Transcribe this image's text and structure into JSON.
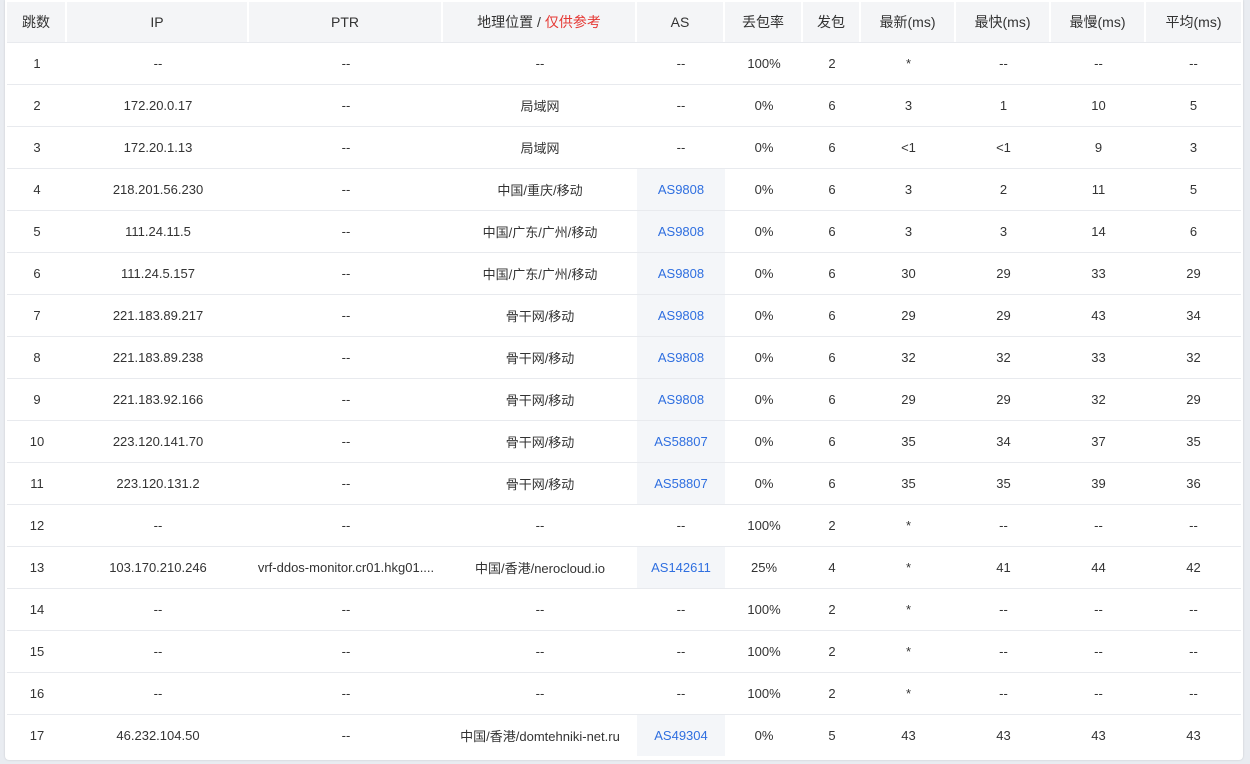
{
  "header": {
    "hop": "跳数",
    "ip": "IP",
    "ptr": "PTR",
    "geo": "地理位置",
    "geo_sep": " / ",
    "geo_note": "仅供参考",
    "as": "AS",
    "loss": "丢包率",
    "sent": "发包",
    "last": "最新(ms)",
    "best": "最快(ms)",
    "worst": "最慢(ms)",
    "avg": "平均(ms)"
  },
  "rows": [
    {
      "hop": "1",
      "ip": "--",
      "ptr": "--",
      "geo": "--",
      "as": "--",
      "as_link": false,
      "loss": "100%",
      "sent": "2",
      "last": "*",
      "best": "--",
      "worst": "--",
      "avg": "--"
    },
    {
      "hop": "2",
      "ip": "172.20.0.17",
      "ptr": "--",
      "geo": "局域网",
      "as": "--",
      "as_link": false,
      "loss": "0%",
      "sent": "6",
      "last": "3",
      "best": "1",
      "worst": "10",
      "avg": "5"
    },
    {
      "hop": "3",
      "ip": "172.20.1.13",
      "ptr": "--",
      "geo": "局域网",
      "as": "--",
      "as_link": false,
      "loss": "0%",
      "sent": "6",
      "last": "<1",
      "best": "<1",
      "worst": "9",
      "avg": "3"
    },
    {
      "hop": "4",
      "ip": "218.201.56.230",
      "ptr": "--",
      "geo": "中国/重庆/移动",
      "as": "AS9808",
      "as_link": true,
      "loss": "0%",
      "sent": "6",
      "last": "3",
      "best": "2",
      "worst": "11",
      "avg": "5"
    },
    {
      "hop": "5",
      "ip": "111.24.11.5",
      "ptr": "--",
      "geo": "中国/广东/广州/移动",
      "as": "AS9808",
      "as_link": true,
      "loss": "0%",
      "sent": "6",
      "last": "3",
      "best": "3",
      "worst": "14",
      "avg": "6"
    },
    {
      "hop": "6",
      "ip": "111.24.5.157",
      "ptr": "--",
      "geo": "中国/广东/广州/移动",
      "as": "AS9808",
      "as_link": true,
      "loss": "0%",
      "sent": "6",
      "last": "30",
      "best": "29",
      "worst": "33",
      "avg": "29"
    },
    {
      "hop": "7",
      "ip": "221.183.89.217",
      "ptr": "--",
      "geo": "骨干网/移动",
      "as": "AS9808",
      "as_link": true,
      "loss": "0%",
      "sent": "6",
      "last": "29",
      "best": "29",
      "worst": "43",
      "avg": "34"
    },
    {
      "hop": "8",
      "ip": "221.183.89.238",
      "ptr": "--",
      "geo": "骨干网/移动",
      "as": "AS9808",
      "as_link": true,
      "loss": "0%",
      "sent": "6",
      "last": "32",
      "best": "32",
      "worst": "33",
      "avg": "32"
    },
    {
      "hop": "9",
      "ip": "221.183.92.166",
      "ptr": "--",
      "geo": "骨干网/移动",
      "as": "AS9808",
      "as_link": true,
      "loss": "0%",
      "sent": "6",
      "last": "29",
      "best": "29",
      "worst": "32",
      "avg": "29"
    },
    {
      "hop": "10",
      "ip": "223.120.141.70",
      "ptr": "--",
      "geo": "骨干网/移动",
      "as": "AS58807",
      "as_link": true,
      "loss": "0%",
      "sent": "6",
      "last": "35",
      "best": "34",
      "worst": "37",
      "avg": "35"
    },
    {
      "hop": "11",
      "ip": "223.120.131.2",
      "ptr": "--",
      "geo": "骨干网/移动",
      "as": "AS58807",
      "as_link": true,
      "loss": "0%",
      "sent": "6",
      "last": "35",
      "best": "35",
      "worst": "39",
      "avg": "36"
    },
    {
      "hop": "12",
      "ip": "--",
      "ptr": "--",
      "geo": "--",
      "as": "--",
      "as_link": false,
      "loss": "100%",
      "sent": "2",
      "last": "*",
      "best": "--",
      "worst": "--",
      "avg": "--"
    },
    {
      "hop": "13",
      "ip": "103.170.210.246",
      "ptr": "vrf-ddos-monitor.cr01.hkg01....",
      "geo": "中国/香港/nerocloud.io",
      "as": "AS142611",
      "as_link": true,
      "loss": "25%",
      "sent": "4",
      "last": "*",
      "best": "41",
      "worst": "44",
      "avg": "42"
    },
    {
      "hop": "14",
      "ip": "--",
      "ptr": "--",
      "geo": "--",
      "as": "--",
      "as_link": false,
      "loss": "100%",
      "sent": "2",
      "last": "*",
      "best": "--",
      "worst": "--",
      "avg": "--"
    },
    {
      "hop": "15",
      "ip": "--",
      "ptr": "--",
      "geo": "--",
      "as": "--",
      "as_link": false,
      "loss": "100%",
      "sent": "2",
      "last": "*",
      "best": "--",
      "worst": "--",
      "avg": "--"
    },
    {
      "hop": "16",
      "ip": "--",
      "ptr": "--",
      "geo": "--",
      "as": "--",
      "as_link": false,
      "loss": "100%",
      "sent": "2",
      "last": "*",
      "best": "--",
      "worst": "--",
      "avg": "--"
    },
    {
      "hop": "17",
      "ip": "46.232.104.50",
      "ptr": "--",
      "geo": "中国/香港/domtehniki-net.ru",
      "as": "AS49304",
      "as_link": true,
      "loss": "0%",
      "sent": "5",
      "last": "43",
      "best": "43",
      "worst": "43",
      "avg": "43"
    }
  ],
  "colors": {
    "link": "#2f6fe0",
    "warning": "#e53935",
    "header_bg": "#f4f5f7"
  }
}
